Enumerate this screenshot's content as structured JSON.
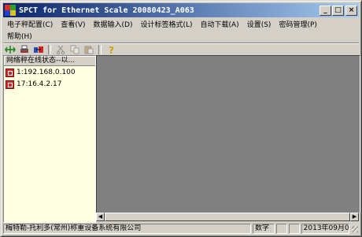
{
  "window": {
    "title": "SPCT for Ethernet Scale 20080423_A063",
    "controls": {
      "minimize": "_",
      "maximize": "□",
      "close": "×"
    }
  },
  "menu": {
    "row1": [
      "电子秤配置(C)",
      "查看(V)",
      "数据输入(D)",
      "设计标签格式(L)",
      "自动下载(A)",
      "设置(S)",
      "密码管理(P)"
    ],
    "row2": [
      "帮助(H)"
    ]
  },
  "toolbar": {
    "tools": [
      {
        "icon": "network-connect-icon",
        "enabled": true
      },
      {
        "icon": "printer-download-icon",
        "enabled": true
      },
      {
        "icon": "scale-disconnect-icon",
        "enabled": true
      },
      {
        "icon": "cut-icon",
        "enabled": false
      },
      {
        "icon": "copy-icon",
        "enabled": false
      },
      {
        "icon": "paste-icon",
        "enabled": false
      },
      {
        "icon": "help-icon",
        "enabled": true
      }
    ]
  },
  "tree": {
    "header": "网络秤在线状态--以...",
    "nodes": [
      {
        "label": "1:192.168.0.100",
        "icon": "scale-node-icon"
      },
      {
        "label": "17:16.4.2.17",
        "icon": "scale-node-icon"
      }
    ]
  },
  "status": {
    "company": "梅特勒-托利多(常州)称重设备系统有限公司",
    "mode": "数字",
    "date": "2013年09月09日"
  }
}
